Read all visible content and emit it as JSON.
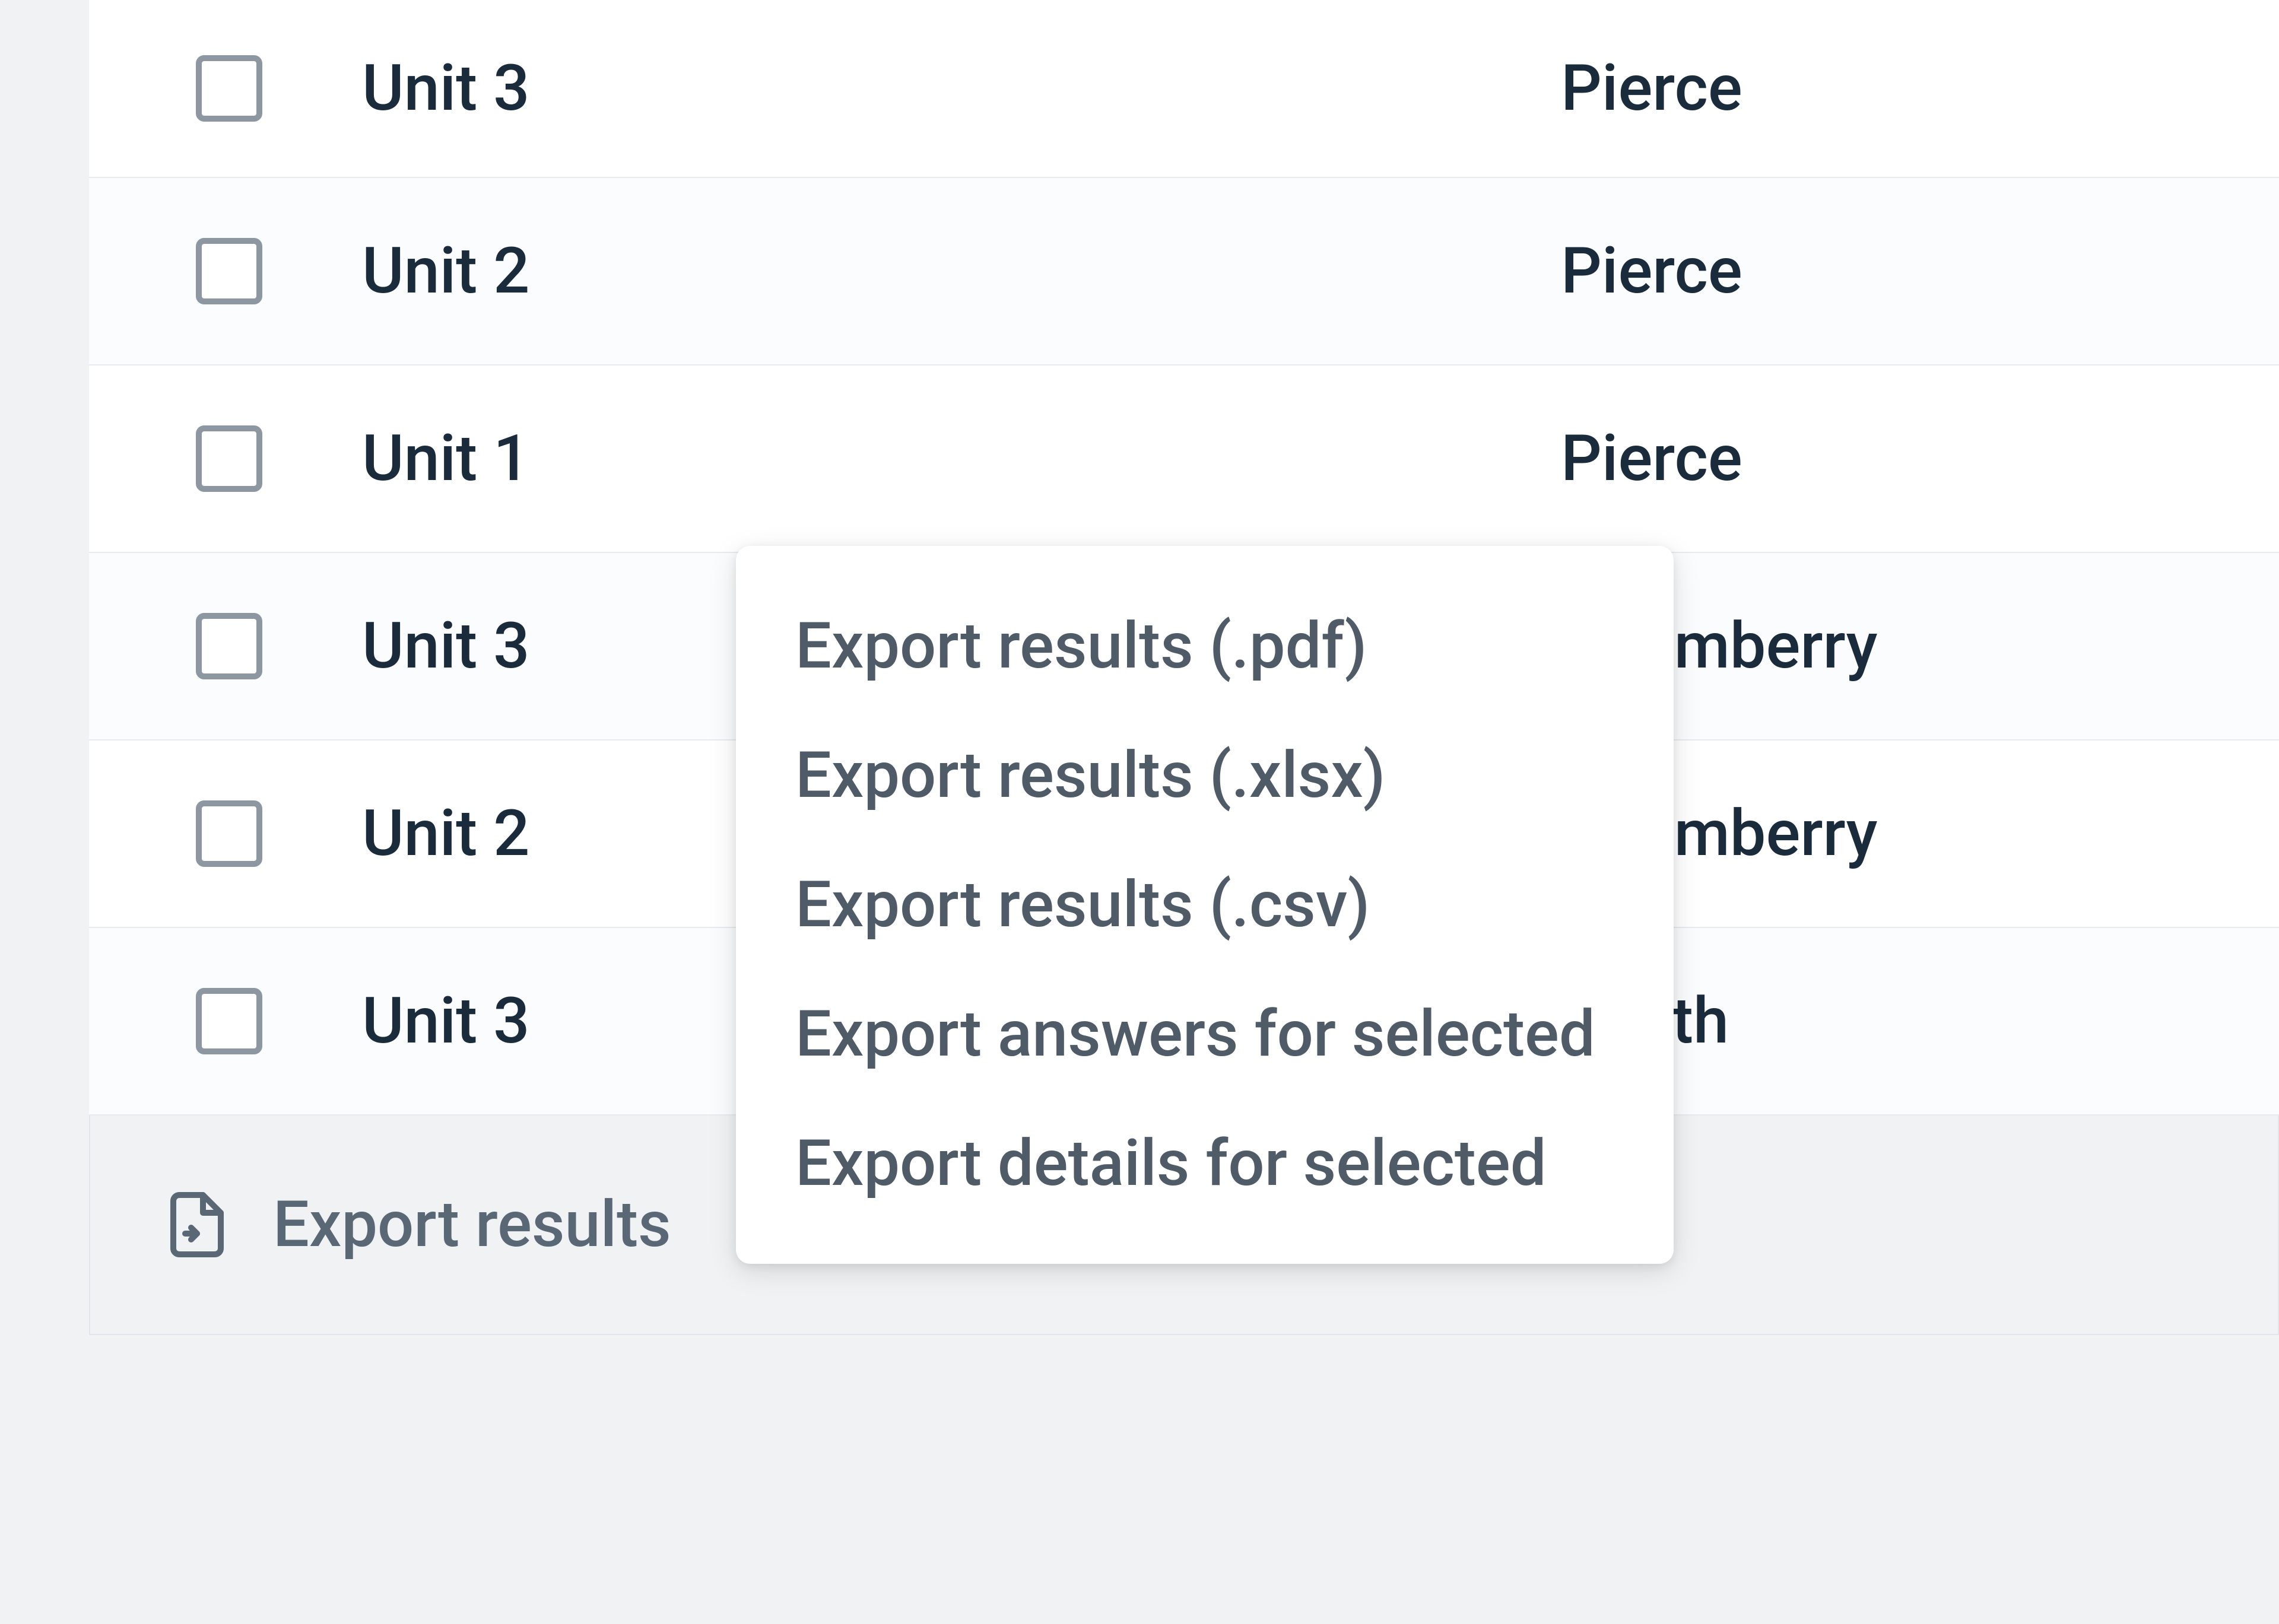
{
  "table": {
    "rows": [
      {
        "unit": "Unit 3",
        "name": "Pierce"
      },
      {
        "unit": "Unit 2",
        "name": "Pierce"
      },
      {
        "unit": "Unit 1",
        "name": "Pierce"
      },
      {
        "unit": "Unit 3",
        "name": "Adamberry"
      },
      {
        "unit": "Unit 2",
        "name": "Adamberry"
      },
      {
        "unit": "Unit 3",
        "name": "Smith"
      }
    ]
  },
  "footer": {
    "export_label": "Export results"
  },
  "menu": {
    "items": [
      "Export results (.pdf)",
      "Export results (.xlsx)",
      "Export results (.csv)",
      "Export answers for selected",
      "Export details for selected"
    ]
  }
}
